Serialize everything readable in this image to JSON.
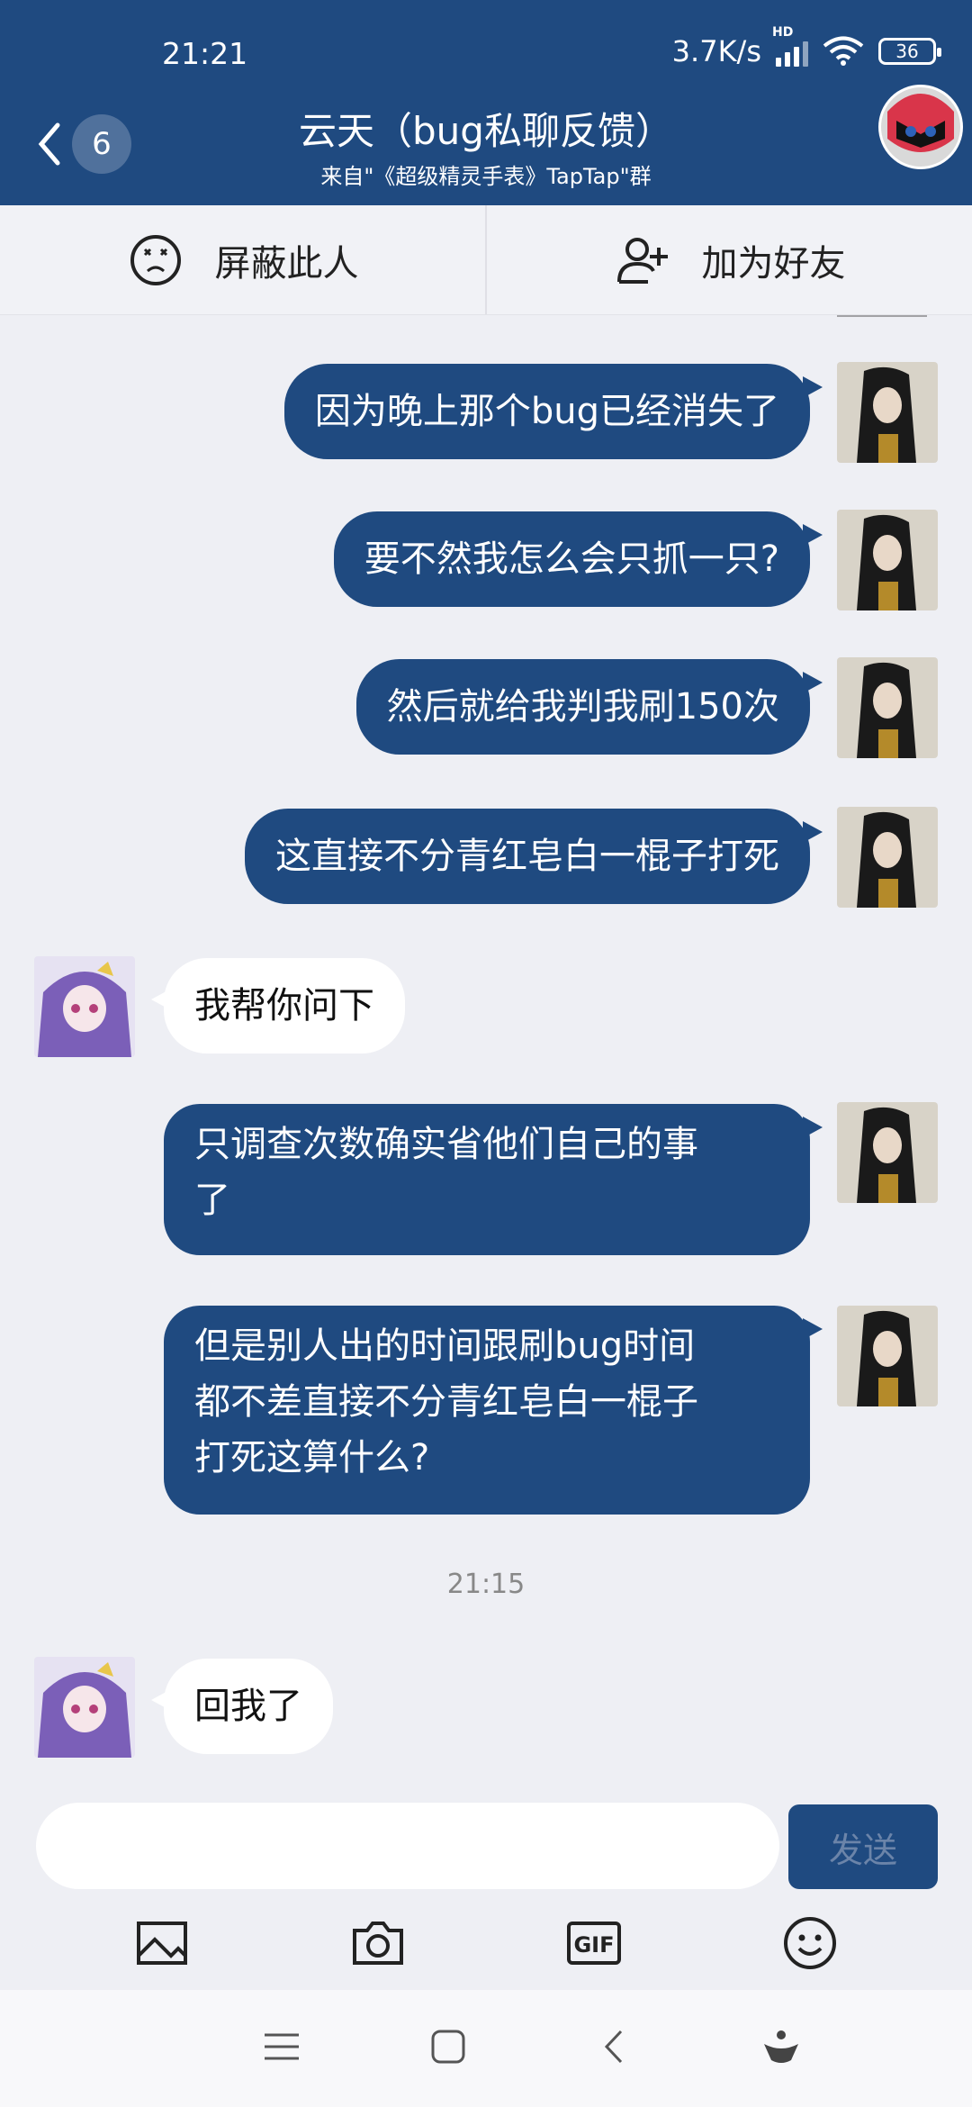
{
  "status_bar": {
    "time": "21:21",
    "network_speed": "3.7K/s",
    "signal_tag": "HD",
    "battery": "36"
  },
  "header": {
    "back_badge": "6",
    "title": "云天（bug私聊反馈）",
    "subtitle": "来自\"《超级精灵手表》TapTap\"群"
  },
  "actions": {
    "block_label": "屏蔽此人",
    "add_friend_label": "加为好友"
  },
  "messages": [
    {
      "side": "me",
      "text": "因为晚上那个bug已经消失了"
    },
    {
      "side": "me",
      "text": "要不然我怎么会只抓一只?"
    },
    {
      "side": "me",
      "text": "然后就给我判我刷150次"
    },
    {
      "side": "me",
      "text": "这直接不分青红皂白一棍子打死"
    },
    {
      "side": "them",
      "text": "我帮你问下"
    },
    {
      "side": "me",
      "lines": [
        "只调查次数确实省他们自己的事",
        "了"
      ]
    },
    {
      "side": "me",
      "lines": [
        "但是别人出的时间跟刷bug时间",
        "都不差直接不分青红皂白一棍子",
        "打死这算什么?"
      ]
    },
    {
      "side": "time",
      "text": "21:15"
    },
    {
      "side": "them",
      "text": "回我了"
    }
  ],
  "input": {
    "placeholder": "",
    "send_label": "发送"
  },
  "toolbar": [
    "image-icon",
    "camera-icon",
    "gif-icon",
    "emoji-icon"
  ],
  "colors": {
    "primary": "#1f4a80",
    "background": "#eeeff4",
    "bubble_them": "#ffffff"
  }
}
